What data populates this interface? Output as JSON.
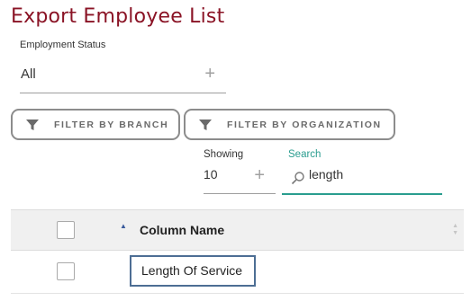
{
  "page": {
    "title": "Export Employee List"
  },
  "employment_status": {
    "label": "Employment Status",
    "value": "All",
    "add_icon": "plus-icon"
  },
  "filters": [
    {
      "label": "FILTER BY BRANCH",
      "icon": "funnel-icon"
    },
    {
      "label": "FILTER BY ORGANIZATION",
      "icon": "funnel-icon"
    }
  ],
  "showing": {
    "label": "Showing",
    "value": "10",
    "add_icon": "plus-icon"
  },
  "search": {
    "label": "Search",
    "value": "length",
    "icon": "search-icon"
  },
  "table": {
    "columns": [
      {
        "label": "Column Name",
        "sort": "ascending"
      }
    ],
    "rows": [
      {
        "column_name": "Length Of Service",
        "selected": false
      }
    ]
  },
  "colors": {
    "title": "#8a1325",
    "accent": "#2a9d8f",
    "highlight_border": "#4d6e94",
    "header_bg": "#f0f0f0"
  }
}
